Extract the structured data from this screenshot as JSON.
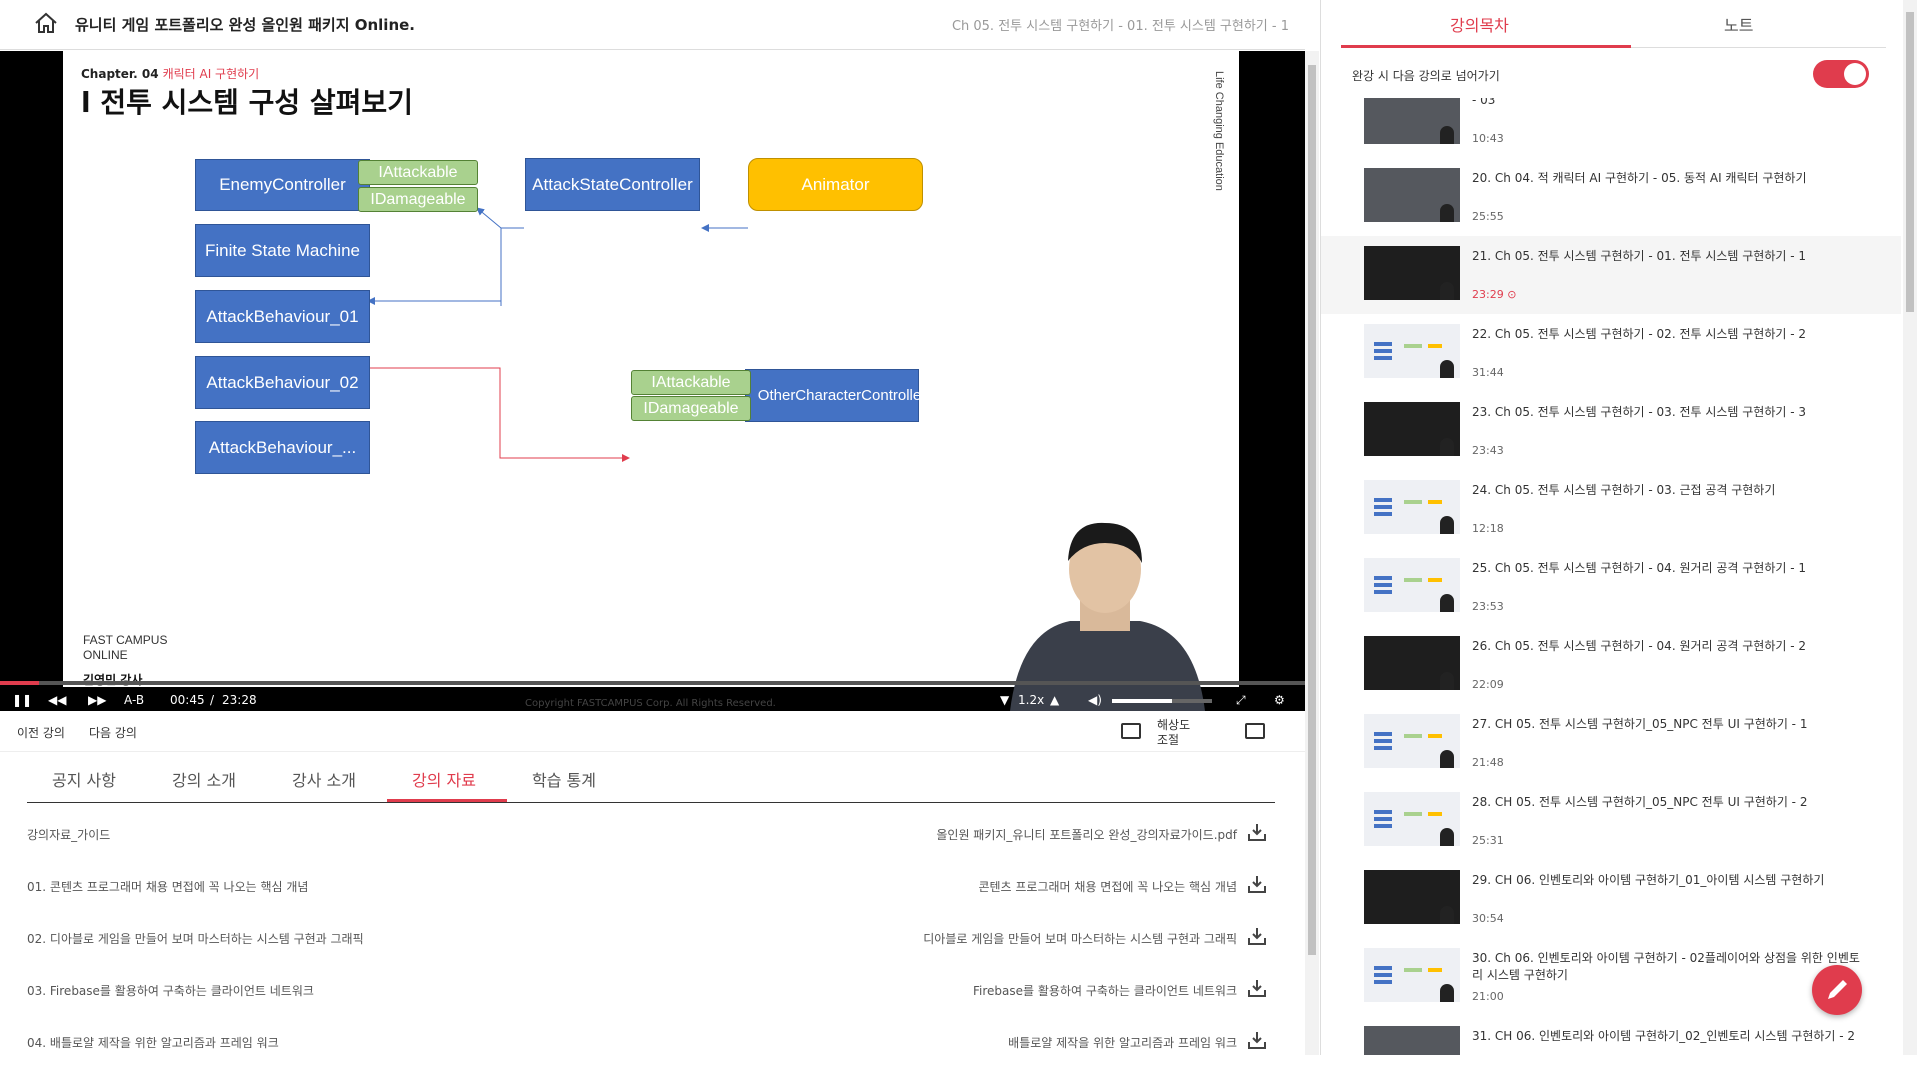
{
  "header": {
    "course_title": "유니티 게임 포트폴리오 완성 올인원 패키지 Online.",
    "lecture_crumb": "Ch 05. 전투 시스템 구현하기 - 01. 전투 시스템 구현하기 - 1"
  },
  "slide": {
    "chapter_label": "Chapter. 04",
    "chapter_sub": "캐릭터 AI 구현하기",
    "title": "l 전투 시스템 구성 살펴보기",
    "side_brand": "Life Changing Education",
    "brand_line1": "FAST CAMPUS",
    "brand_line2": "ONLINE",
    "teacher": "김영민 강사.",
    "copyright": "Copyright FASTCAMPUS Corp. All Rights Reserved.",
    "boxes": {
      "enemy_controller": "EnemyController",
      "iattackable_1": "IAttackable",
      "idamageable_1": "IDamageable",
      "attack_state_controller": "AttackStateController",
      "animator": "Animator",
      "fsm": "Finite State Machine",
      "behaviour_01": "AttackBehaviour_01",
      "behaviour_02": "AttackBehaviour_02",
      "behaviour_more": "AttackBehaviour_...",
      "iattackable_2": "IAttackable",
      "idamageable_2": "IDamageable",
      "other_character": "OtherCharacterController"
    }
  },
  "player": {
    "progress": 0.03,
    "ab_label": "A-B",
    "time_current": "00:45",
    "time_sep": "/",
    "time_total": "23:28",
    "speed": "1.2x",
    "volume": 0.6,
    "colors": {
      "accent": "#e03c4d"
    }
  },
  "below": {
    "prev": "이전 강의",
    "next": "다음 강의",
    "resolution_line1": "해상도",
    "resolution_line2": "조절"
  },
  "tabs": [
    "공지 사항",
    "강의 소개",
    "강사 소개",
    "강의 자료",
    "학습 통계"
  ],
  "active_tab": 3,
  "resources": [
    {
      "name": "강의자료_가이드",
      "file": "올인원 패키지_유니티 포트폴리오 완성_강의자료가이드.pdf"
    },
    {
      "name": "01. 콘텐츠 프로그래머 채용 면접에 꼭 나오는 핵심 개념",
      "file": "콘텐츠 프로그래머 채용 면접에 꼭 나오는 핵심 개념"
    },
    {
      "name": "02. 디아블로 게임을 만들어 보며 마스터하는 시스템 구현과 그래픽",
      "file": "디아블로 게임을 만들어 보며 마스터하는 시스템 구현과 그래픽"
    },
    {
      "name": "03. Firebase를 활용하여 구축하는 클라이언트 네트워크",
      "file": "Firebase를 활용하여 구축하는 클라이언트 네트워크"
    },
    {
      "name": "04. 배틀로얄 제작을 위한 알고리즘과 프레임 워크",
      "file": "배틀로얄 제작을 위한 알고리즘과 프레임 워크"
    }
  ],
  "right_panel": {
    "tab_toc": "강의목차",
    "tab_note": "노트",
    "auto_next": "완강 시 다음 강의로 넘어가기",
    "auto_next_on": true,
    "items": [
      {
        "title": "- 03",
        "duration": "10:43",
        "thumb": "gray"
      },
      {
        "title": "20. Ch 04. 적 캐릭터 AI 구현하기 - 05. 동적 AI 캐릭터 구현하기",
        "duration": "25:55",
        "thumb": "gray"
      },
      {
        "title": "21. Ch 05. 전투 시스템 구현하기 - 01. 전투 시스템 구현하기 - 1",
        "duration": "23:29",
        "thumb": "dark",
        "current": true
      },
      {
        "title": "22. Ch 05. 전투 시스템 구현하기 - 02. 전투 시스템 구현하기 - 2",
        "duration": "31:44",
        "thumb": "light"
      },
      {
        "title": "23. Ch 05. 전투 시스템 구현하기 - 03. 전투 시스템 구현하기 - 3",
        "duration": "23:43",
        "thumb": "dark"
      },
      {
        "title": "24. Ch 05. 전투 시스템 구현하기 - 03. 근접 공격 구현하기",
        "duration": "12:18",
        "thumb": "light"
      },
      {
        "title": "25. Ch 05. 전투 시스템 구현하기 - 04. 원거리 공격 구현하기 - 1",
        "duration": "23:53",
        "thumb": "light"
      },
      {
        "title": "26. Ch 05. 전투 시스템 구현하기 - 04. 원거리 공격 구현하기 - 2",
        "duration": "22:09",
        "thumb": "dark"
      },
      {
        "title": "27. CH 05. 전투 시스템 구현하기_05_NPC 전투 UI 구현하기 - 1",
        "duration": "21:48",
        "thumb": "light"
      },
      {
        "title": "28. CH 05. 전투 시스템 구현하기_05_NPC 전투 UI 구현하기 - 2",
        "duration": "25:31",
        "thumb": "light"
      },
      {
        "title": "29. CH 06. 인벤토리와 아이템 구현하기_01_아이템 시스템 구현하기",
        "duration": "30:54",
        "thumb": "dark"
      },
      {
        "title": "30. Ch 06. 인벤토리와 아이템 구현하기 - 02플레이어와 상점을 위한 인벤토리 시스템 구현하기",
        "duration": "21:00",
        "thumb": "light"
      },
      {
        "title": "31. CH 06. 인벤토리와 아이템 구현하기_02_인벤토리 시스템 구현하기 - 2",
        "duration": "",
        "thumb": "gray"
      }
    ]
  }
}
